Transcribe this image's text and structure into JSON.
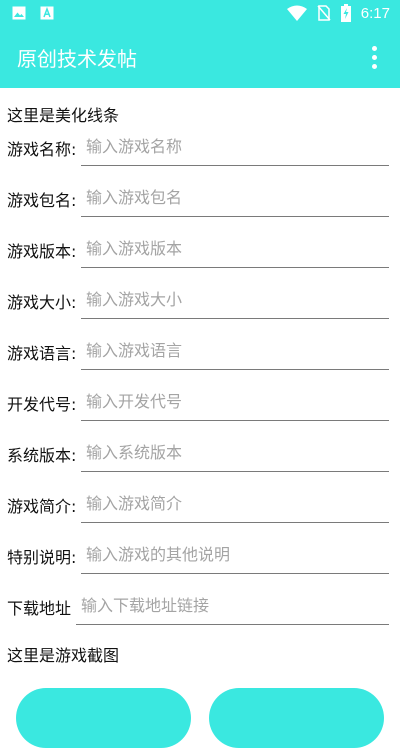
{
  "status_bar": {
    "time": "6:17",
    "icons": [
      "image-icon",
      "a-icon",
      "wifi-icon",
      "no-sim-icon",
      "battery-charging-icon"
    ]
  },
  "toolbar": {
    "title": "原创技术发帖",
    "menu_icon": "more-vert-icon"
  },
  "decor_label": "这里是美化线条",
  "fields": [
    {
      "label": "游戏名称:",
      "placeholder": "输入游戏名称"
    },
    {
      "label": "游戏包名:",
      "placeholder": "输入游戏包名"
    },
    {
      "label": "游戏版本:",
      "placeholder": "输入游戏版本"
    },
    {
      "label": "游戏大小:",
      "placeholder": "输入游戏大小"
    },
    {
      "label": "游戏语言:",
      "placeholder": "输入游戏语言"
    },
    {
      "label": "开发代号:",
      "placeholder": "输入开发代号"
    },
    {
      "label": "系统版本:",
      "placeholder": "输入系统版本"
    },
    {
      "label": "游戏简介:",
      "placeholder": "输入游戏简介"
    },
    {
      "label": "特别说明:",
      "placeholder": "输入游戏的其他说明"
    },
    {
      "label": "下载地址",
      "placeholder": "输入下载地址链接"
    }
  ],
  "screenshot_label": "这里是游戏截图",
  "buttons": {
    "left_label": "",
    "right_label": ""
  },
  "colors": {
    "accent": "#3ae8e0",
    "underline": "#7a7a7a",
    "placeholder": "#a4a4a4"
  }
}
